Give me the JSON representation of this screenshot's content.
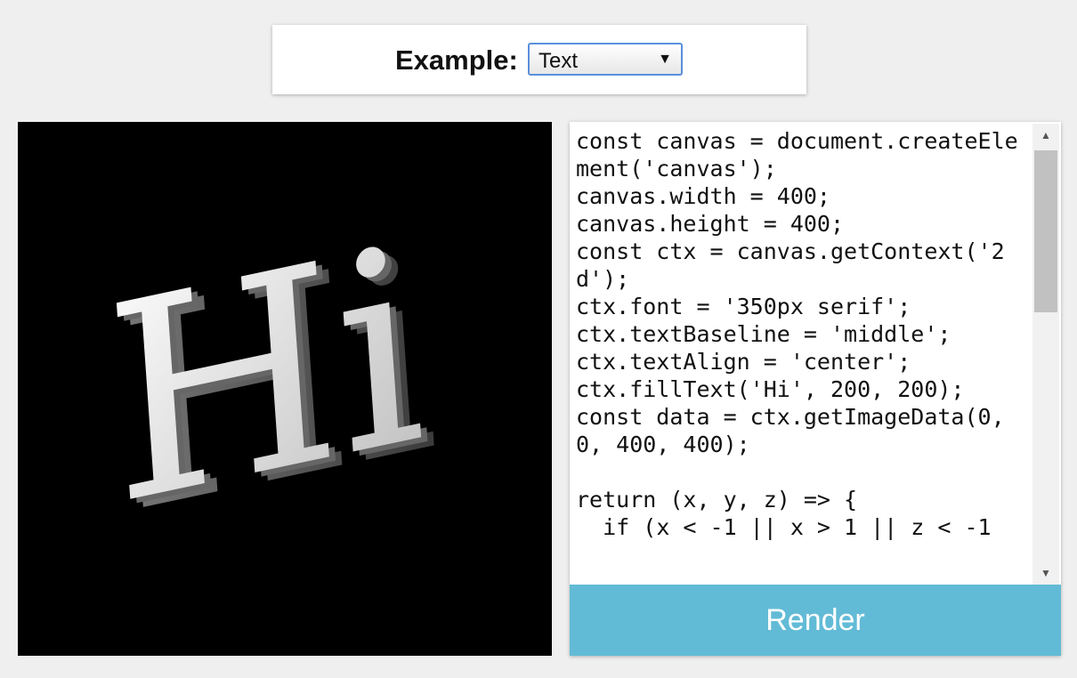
{
  "toolbar": {
    "example_label": "Example:",
    "example_select": {
      "value": "Text",
      "arrow_icon": "triangle-down-icon"
    }
  },
  "viewport": {
    "render_text": "Hi",
    "background": "#000000"
  },
  "editor": {
    "code": "const canvas = document.createElement('canvas');\ncanvas.width = 400;\ncanvas.height = 400;\nconst ctx = canvas.getContext('2d');\nctx.font = '350px serif';\nctx.textBaseline = 'middle';\nctx.textAlign = 'center';\nctx.fillText('Hi', 200, 200);\nconst data = ctx.getImageData(0, 0, 400, 400);\n\nreturn (x, y, z) => {\n  if (x < -1 || x > 1 || z < -1",
    "render_button_label": "Render"
  },
  "colors": {
    "accent": "#62bbd6",
    "select_border": "#5b8fdc",
    "page_background": "#efefef"
  }
}
